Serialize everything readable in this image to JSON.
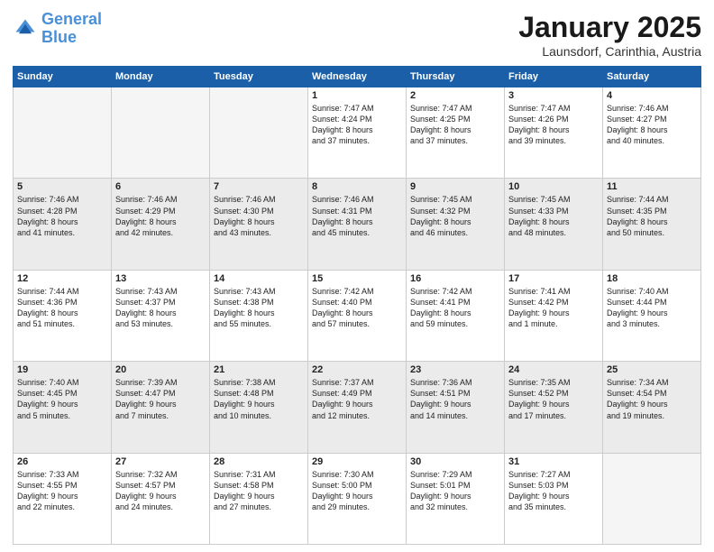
{
  "logo": {
    "text_general": "General",
    "text_blue": "Blue"
  },
  "header": {
    "month": "January 2025",
    "location": "Launsdorf, Carinthia, Austria"
  },
  "weekdays": [
    "Sunday",
    "Monday",
    "Tuesday",
    "Wednesday",
    "Thursday",
    "Friday",
    "Saturday"
  ],
  "weeks": [
    {
      "alt": false,
      "days": [
        {
          "num": "",
          "info": "",
          "empty": true
        },
        {
          "num": "",
          "info": "",
          "empty": true
        },
        {
          "num": "",
          "info": "",
          "empty": true
        },
        {
          "num": "1",
          "info": "Sunrise: 7:47 AM\nSunset: 4:24 PM\nDaylight: 8 hours\nand 37 minutes.",
          "empty": false
        },
        {
          "num": "2",
          "info": "Sunrise: 7:47 AM\nSunset: 4:25 PM\nDaylight: 8 hours\nand 37 minutes.",
          "empty": false
        },
        {
          "num": "3",
          "info": "Sunrise: 7:47 AM\nSunset: 4:26 PM\nDaylight: 8 hours\nand 39 minutes.",
          "empty": false
        },
        {
          "num": "4",
          "info": "Sunrise: 7:46 AM\nSunset: 4:27 PM\nDaylight: 8 hours\nand 40 minutes.",
          "empty": false
        }
      ]
    },
    {
      "alt": true,
      "days": [
        {
          "num": "5",
          "info": "Sunrise: 7:46 AM\nSunset: 4:28 PM\nDaylight: 8 hours\nand 41 minutes.",
          "empty": false
        },
        {
          "num": "6",
          "info": "Sunrise: 7:46 AM\nSunset: 4:29 PM\nDaylight: 8 hours\nand 42 minutes.",
          "empty": false
        },
        {
          "num": "7",
          "info": "Sunrise: 7:46 AM\nSunset: 4:30 PM\nDaylight: 8 hours\nand 43 minutes.",
          "empty": false
        },
        {
          "num": "8",
          "info": "Sunrise: 7:46 AM\nSunset: 4:31 PM\nDaylight: 8 hours\nand 45 minutes.",
          "empty": false
        },
        {
          "num": "9",
          "info": "Sunrise: 7:45 AM\nSunset: 4:32 PM\nDaylight: 8 hours\nand 46 minutes.",
          "empty": false
        },
        {
          "num": "10",
          "info": "Sunrise: 7:45 AM\nSunset: 4:33 PM\nDaylight: 8 hours\nand 48 minutes.",
          "empty": false
        },
        {
          "num": "11",
          "info": "Sunrise: 7:44 AM\nSunset: 4:35 PM\nDaylight: 8 hours\nand 50 minutes.",
          "empty": false
        }
      ]
    },
    {
      "alt": false,
      "days": [
        {
          "num": "12",
          "info": "Sunrise: 7:44 AM\nSunset: 4:36 PM\nDaylight: 8 hours\nand 51 minutes.",
          "empty": false
        },
        {
          "num": "13",
          "info": "Sunrise: 7:43 AM\nSunset: 4:37 PM\nDaylight: 8 hours\nand 53 minutes.",
          "empty": false
        },
        {
          "num": "14",
          "info": "Sunrise: 7:43 AM\nSunset: 4:38 PM\nDaylight: 8 hours\nand 55 minutes.",
          "empty": false
        },
        {
          "num": "15",
          "info": "Sunrise: 7:42 AM\nSunset: 4:40 PM\nDaylight: 8 hours\nand 57 minutes.",
          "empty": false
        },
        {
          "num": "16",
          "info": "Sunrise: 7:42 AM\nSunset: 4:41 PM\nDaylight: 8 hours\nand 59 minutes.",
          "empty": false
        },
        {
          "num": "17",
          "info": "Sunrise: 7:41 AM\nSunset: 4:42 PM\nDaylight: 9 hours\nand 1 minute.",
          "empty": false
        },
        {
          "num": "18",
          "info": "Sunrise: 7:40 AM\nSunset: 4:44 PM\nDaylight: 9 hours\nand 3 minutes.",
          "empty": false
        }
      ]
    },
    {
      "alt": true,
      "days": [
        {
          "num": "19",
          "info": "Sunrise: 7:40 AM\nSunset: 4:45 PM\nDaylight: 9 hours\nand 5 minutes.",
          "empty": false
        },
        {
          "num": "20",
          "info": "Sunrise: 7:39 AM\nSunset: 4:47 PM\nDaylight: 9 hours\nand 7 minutes.",
          "empty": false
        },
        {
          "num": "21",
          "info": "Sunrise: 7:38 AM\nSunset: 4:48 PM\nDaylight: 9 hours\nand 10 minutes.",
          "empty": false
        },
        {
          "num": "22",
          "info": "Sunrise: 7:37 AM\nSunset: 4:49 PM\nDaylight: 9 hours\nand 12 minutes.",
          "empty": false
        },
        {
          "num": "23",
          "info": "Sunrise: 7:36 AM\nSunset: 4:51 PM\nDaylight: 9 hours\nand 14 minutes.",
          "empty": false
        },
        {
          "num": "24",
          "info": "Sunrise: 7:35 AM\nSunset: 4:52 PM\nDaylight: 9 hours\nand 17 minutes.",
          "empty": false
        },
        {
          "num": "25",
          "info": "Sunrise: 7:34 AM\nSunset: 4:54 PM\nDaylight: 9 hours\nand 19 minutes.",
          "empty": false
        }
      ]
    },
    {
      "alt": false,
      "days": [
        {
          "num": "26",
          "info": "Sunrise: 7:33 AM\nSunset: 4:55 PM\nDaylight: 9 hours\nand 22 minutes.",
          "empty": false
        },
        {
          "num": "27",
          "info": "Sunrise: 7:32 AM\nSunset: 4:57 PM\nDaylight: 9 hours\nand 24 minutes.",
          "empty": false
        },
        {
          "num": "28",
          "info": "Sunrise: 7:31 AM\nSunset: 4:58 PM\nDaylight: 9 hours\nand 27 minutes.",
          "empty": false
        },
        {
          "num": "29",
          "info": "Sunrise: 7:30 AM\nSunset: 5:00 PM\nDaylight: 9 hours\nand 29 minutes.",
          "empty": false
        },
        {
          "num": "30",
          "info": "Sunrise: 7:29 AM\nSunset: 5:01 PM\nDaylight: 9 hours\nand 32 minutes.",
          "empty": false
        },
        {
          "num": "31",
          "info": "Sunrise: 7:27 AM\nSunset: 5:03 PM\nDaylight: 9 hours\nand 35 minutes.",
          "empty": false
        },
        {
          "num": "",
          "info": "",
          "empty": true
        }
      ]
    }
  ]
}
